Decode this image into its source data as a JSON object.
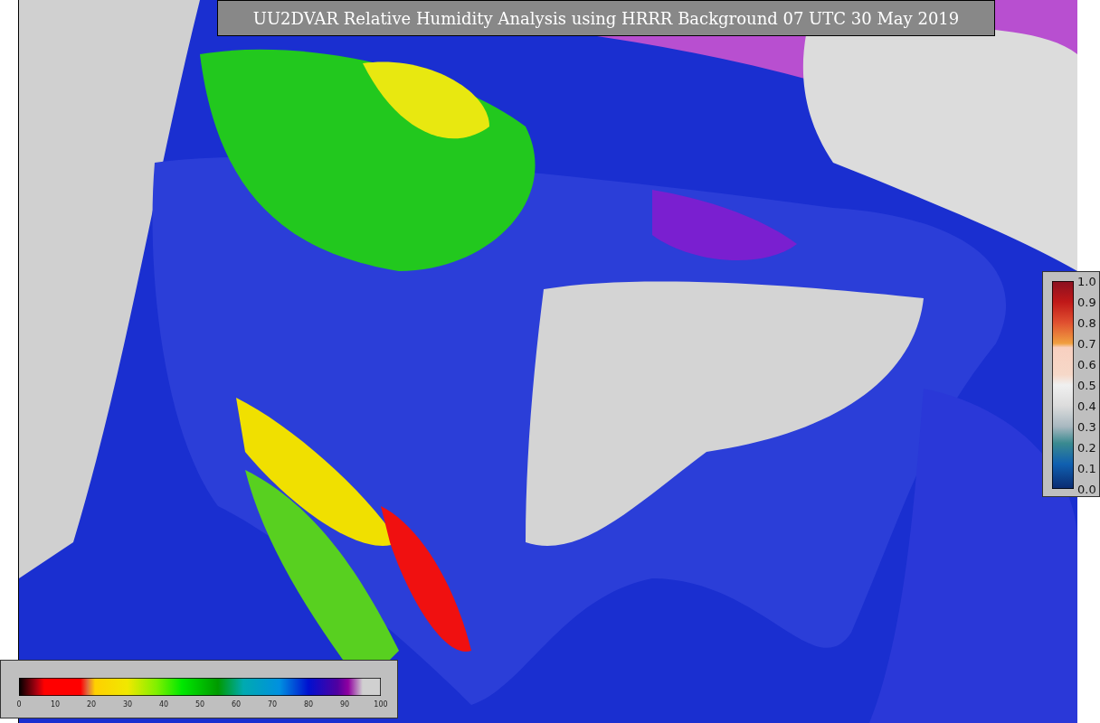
{
  "title": "UU2DVAR Relative Humidity Analysis using HRRR Background 07 UTC 30 May 2019",
  "humidity_scale": {
    "ticks": [
      "0",
      "10",
      "20",
      "30",
      "40",
      "50",
      "60",
      "70",
      "80",
      "90",
      "100"
    ]
  },
  "value_scale": {
    "ticks": [
      "1.0",
      "0.9",
      "0.8",
      "0.7",
      "0.6",
      "0.5",
      "0.4",
      "0.3",
      "0.2",
      "0.1",
      "0.0"
    ]
  }
}
